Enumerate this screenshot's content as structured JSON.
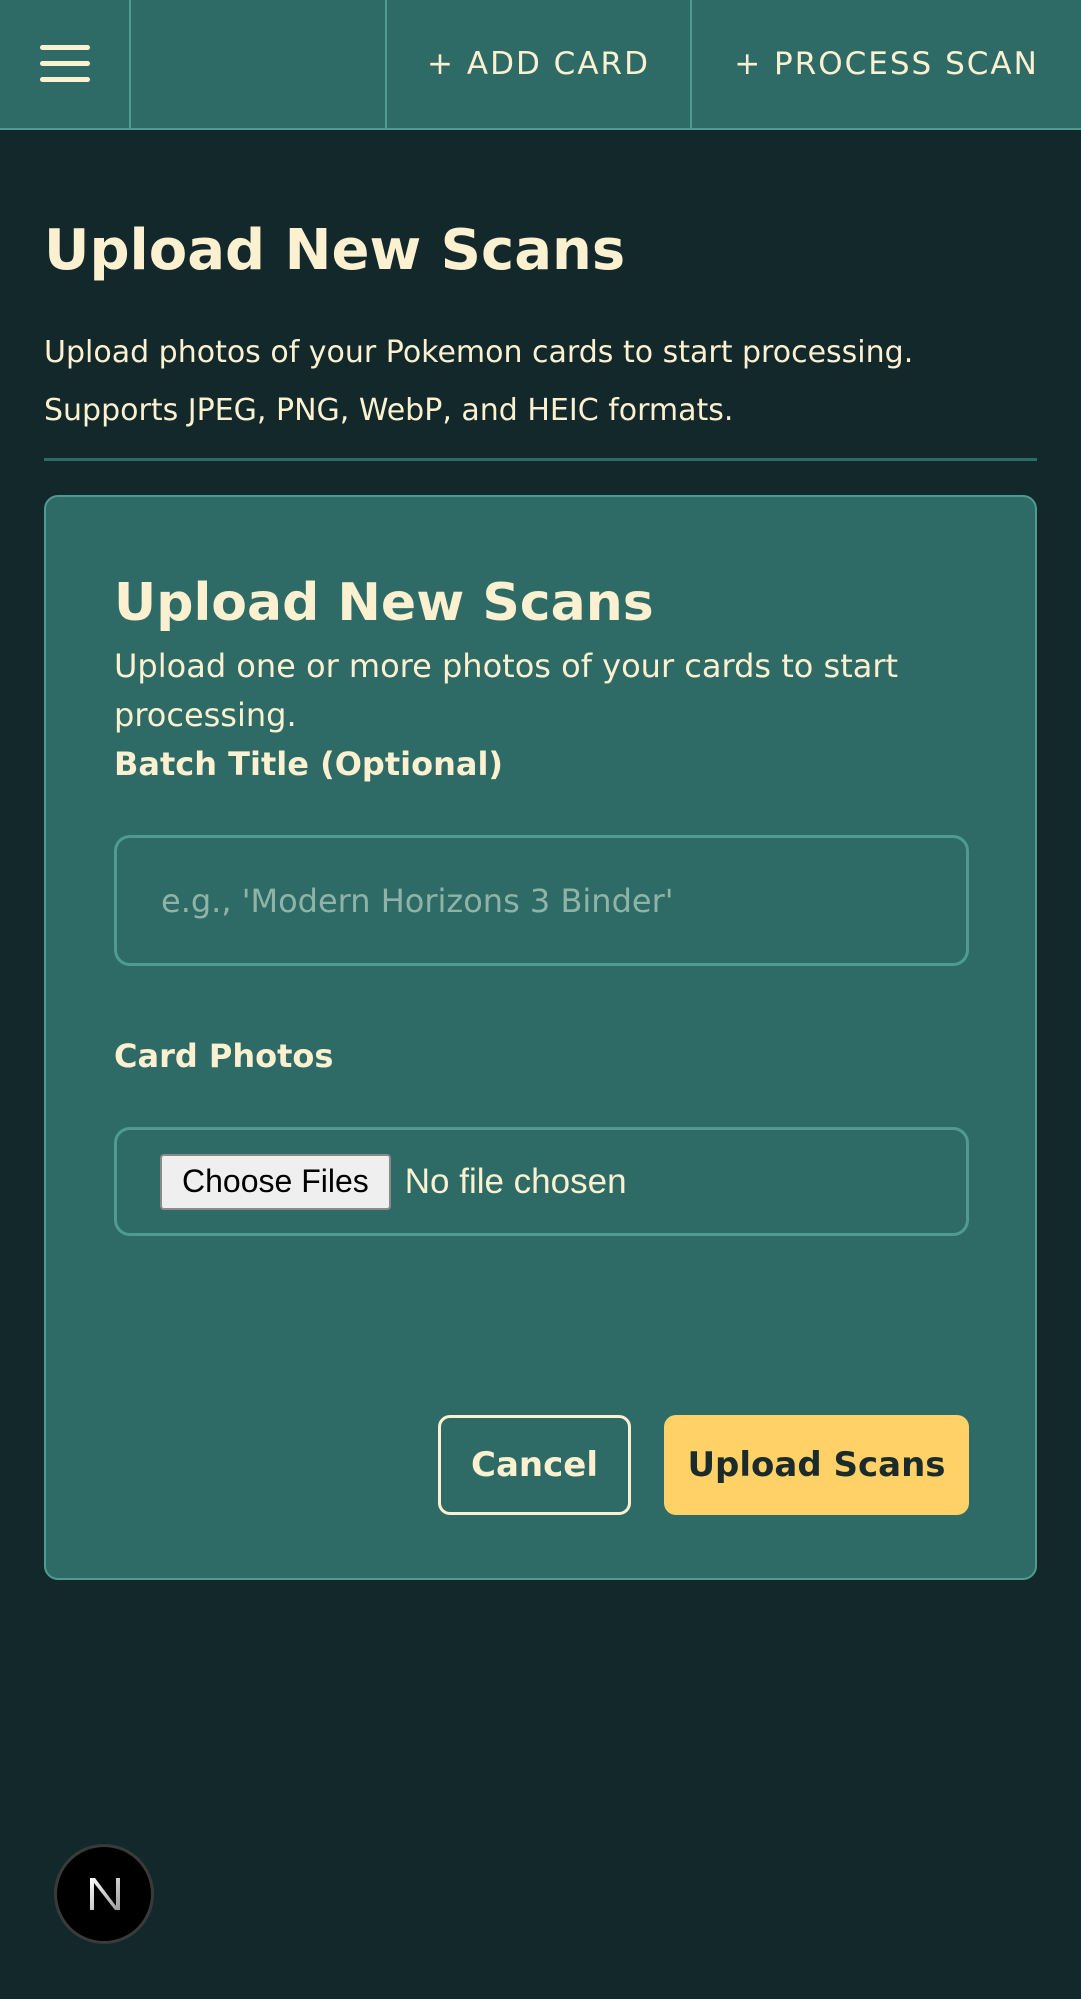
{
  "colors": {
    "background": "#12282a",
    "surface": "#2e6b67",
    "border": "#4f9b92",
    "text": "#fbf0cf",
    "accent": "#ffd166"
  },
  "topbar": {
    "menu_icon": "hamburger-menu-icon",
    "add_card_label": "+ ADD CARD",
    "process_scan_label": "+ PROCESS SCAN"
  },
  "page": {
    "title": "Upload New Scans",
    "description": "Upload photos of your Pokemon cards to start processing. Supports JPEG, PNG, WebP, and HEIC formats."
  },
  "form": {
    "title": "Upload New Scans",
    "description": "Upload one or more photos of your cards to start processing.",
    "batch_title_label": "Batch Title (Optional)",
    "batch_title_placeholder": "e.g., 'Modern Horizons 3 Binder'",
    "batch_title_value": "",
    "card_photos_label": "Card Photos",
    "file_button_label": "Choose Files",
    "file_status": "No file chosen",
    "cancel_label": "Cancel",
    "upload_label": "Upload Scans"
  },
  "badge": {
    "icon": "nextjs-logo-icon",
    "letter": "N"
  }
}
